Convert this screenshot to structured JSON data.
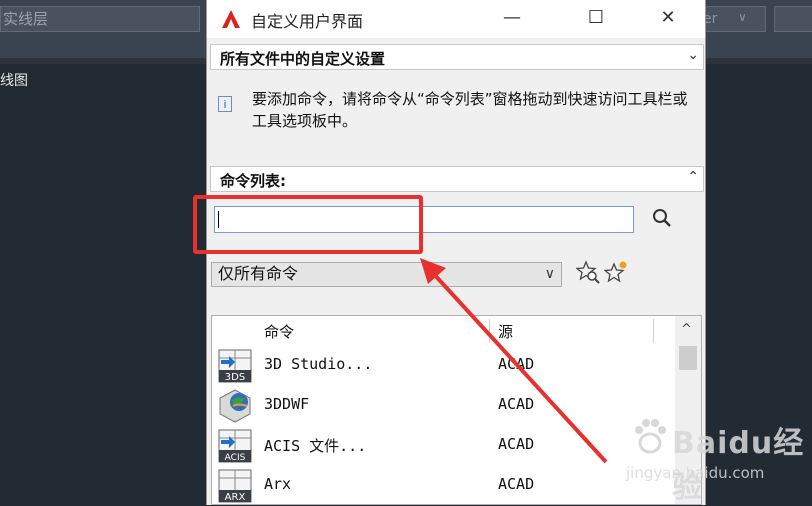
{
  "background": {
    "layer_combo": "实线层",
    "right_combo": "er",
    "right_arrow": "∨",
    "left_label": "线图"
  },
  "dialog": {
    "title": "自定义用户界面",
    "min_glyph": "—",
    "max_glyph": "☐",
    "close_glyph": "✕"
  },
  "customizations": {
    "heading": "所有文件中的自定义设置",
    "toggle": "⌄"
  },
  "info": {
    "icon": "i",
    "text": "要添加命令，请将命令从“命令列表”窗格拖动到快速访问工具栏或工具选项板中。"
  },
  "command_list": {
    "heading": "命令列表:",
    "toggle": "⌃",
    "search_value": "",
    "filter_value": "仅所有命令",
    "filter_arrow": "∨",
    "columns": {
      "command": "命令",
      "source": "源"
    },
    "scroll_up": "^",
    "rows": [
      {
        "name": "3D Studio...",
        "source": "ACAD",
        "icon": "3ds-import-icon"
      },
      {
        "name": "3DDWF",
        "source": "ACAD",
        "icon": "3ddwf-globe-icon"
      },
      {
        "name": "ACIS 文件...",
        "source": "ACAD",
        "icon": "acis-import-icon"
      },
      {
        "name": "Arx",
        "source": "ACAD",
        "icon": "arx-icon"
      }
    ]
  },
  "icons": {
    "search": "magnifier-icon",
    "star_search": "star-search-icon",
    "star_new": "star-new-icon"
  },
  "watermark": {
    "brand": "Baidu经验",
    "url": "jingyan.baidu.com"
  },
  "colors": {
    "highlight": "#e8312e",
    "acad_red": "#d8261e",
    "bg_dark": "#222a33"
  }
}
